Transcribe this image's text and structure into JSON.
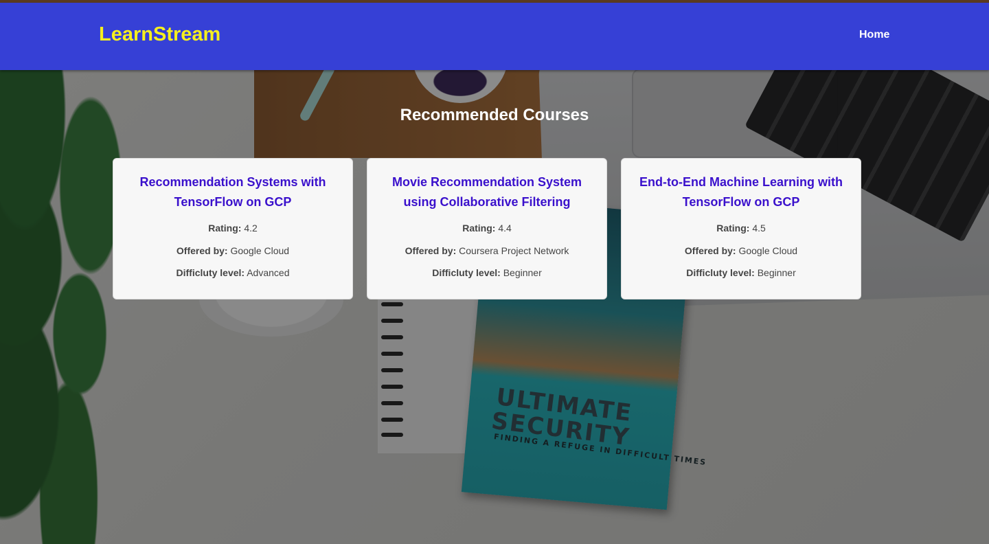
{
  "header": {
    "brand": "LearnStream",
    "nav": [
      {
        "label": "Home"
      }
    ]
  },
  "main": {
    "title": "Recommended Courses",
    "labels": {
      "rating": "Rating:",
      "offered_by": "Offered by:",
      "difficulty": "Difficluty level:"
    },
    "courses": [
      {
        "title": "Recommendation Systems with TensorFlow on GCP",
        "rating": "4.2",
        "offered_by": "Google Cloud",
        "difficulty": "Advanced"
      },
      {
        "title": "Movie Recommendation System using Collaborative Filtering",
        "rating": "4.4",
        "offered_by": "Coursera Project Network",
        "difficulty": "Beginner"
      },
      {
        "title": "End-to-End Machine Learning with TensorFlow on GCP",
        "rating": "4.5",
        "offered_by": "Google Cloud",
        "difficulty": "Beginner"
      }
    ]
  },
  "background_image": {
    "book_title": "ULTIMATE SECURITY",
    "book_subtitle": "FINDING A REFUGE IN DIFFICULT TIMES"
  },
  "colors": {
    "navbar": "#3640d6",
    "brand": "#f5ef1f",
    "course_title": "#3a10cc",
    "card_bg": "#f7f7f7"
  }
}
